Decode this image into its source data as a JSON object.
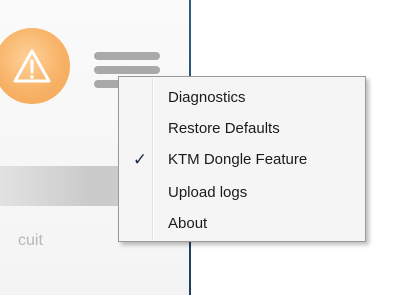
{
  "background": {
    "partial_label": "cuit",
    "accent": "#f4a858",
    "divider_color": "#1c3f5d"
  },
  "menu": {
    "items": [
      {
        "label": "Diagnostics",
        "checked": false
      },
      {
        "label": "Restore Defaults",
        "checked": false
      },
      {
        "label": "KTM Dongle Feature",
        "checked": true
      },
      {
        "label": "Upload logs",
        "checked": false
      },
      {
        "label": "About",
        "checked": false
      }
    ],
    "check_glyph": "✓"
  }
}
